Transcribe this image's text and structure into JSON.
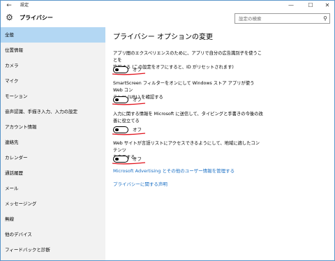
{
  "window": {
    "title": "設定",
    "back_icon": "back-arrow-icon",
    "minimize_icon": "minimize-icon",
    "maximize_icon": "maximize-icon",
    "close_icon": "close-icon"
  },
  "header": {
    "title": "プライバシー",
    "icon": "gear-icon",
    "search_placeholder": "設定の検索",
    "search_icon": "search-icon"
  },
  "sidebar": {
    "items": [
      {
        "label": "全般",
        "active": true
      },
      {
        "label": "位置情報",
        "active": false
      },
      {
        "label": "カメラ",
        "active": false
      },
      {
        "label": "マイク",
        "active": false
      },
      {
        "label": "モーション",
        "active": false
      },
      {
        "label": "音声認識、手描き入力、入力の設定",
        "active": false
      },
      {
        "label": "アカウント情報",
        "active": false
      },
      {
        "label": "連絡先",
        "active": false
      },
      {
        "label": "カレンダー",
        "active": false
      },
      {
        "label": "通話履歴",
        "active": false
      },
      {
        "label": "メール",
        "active": false
      },
      {
        "label": "メッセージング",
        "active": false
      },
      {
        "label": "無線",
        "active": false
      },
      {
        "label": "他のデバイス",
        "active": false
      },
      {
        "label": "フィードバックと診断",
        "active": false
      }
    ]
  },
  "main": {
    "title": "プライバシー オプションの変更",
    "settings": [
      {
        "line1": "アプリ間のエクスペリエンスのために、アプリで自分の広告識別子を使うことを",
        "line2": "許可する (この設定をオフにすると、ID がリセットされます)",
        "state": "オフ"
      },
      {
        "line1": "SmartScreen フィルターをオンにして Windows ストア アプリが使う Web コン",
        "line2": "テンツ (URL) を確認する",
        "state": "オフ"
      },
      {
        "line1": "入力に関する情報を Microsoft に送信して、タイピングと手書きの今後の改",
        "line2": "善に役立てる",
        "state": "オフ"
      },
      {
        "line1": "Web サイトが言語リストにアクセスできるようにして、地域に適したコンテンツ",
        "line2": "を表示する",
        "state": "オフ"
      }
    ],
    "links": [
      "Microsoft Advertising とその他のユーザー情報を管理する",
      "プライバシーに関する声明"
    ]
  },
  "colors": {
    "accent": "#1a6fc4",
    "sidebar_bg": "#f2f2f2",
    "active_item_bg": "#b3d7f3",
    "annotation": "#e0101a",
    "window_border": "#5a95c9"
  }
}
